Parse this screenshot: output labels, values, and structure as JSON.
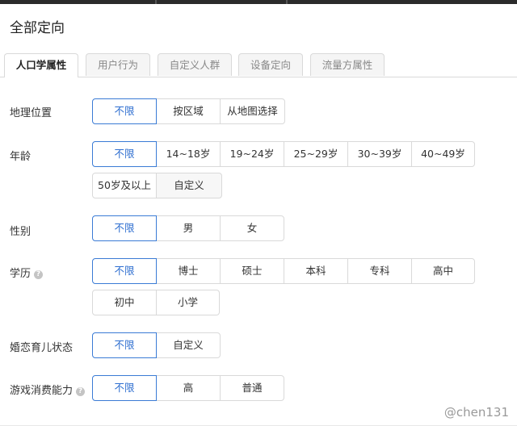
{
  "page": {
    "title": "全部定向"
  },
  "tabs": [
    "人口学属性",
    "用户行为",
    "自定义人群",
    "设备定向",
    "流量方属性"
  ],
  "active_tab": "人口学属性",
  "rows": [
    {
      "label": "地理位置",
      "options": [
        "不限",
        "按区域",
        "从地图选择"
      ]
    },
    {
      "label": "年龄",
      "options": [
        "不限",
        "14~18岁",
        "19~24岁",
        "25~29岁",
        "30~39岁",
        "40~49岁",
        "50岁及以上",
        "自定义"
      ]
    },
    {
      "label": "性别",
      "options": [
        "不限",
        "男",
        "女"
      ]
    },
    {
      "label": "学历",
      "options": [
        "不限",
        "博士",
        "硕士",
        "本科",
        "专科",
        "高中",
        "初中",
        "小学"
      ]
    },
    {
      "label": "婚恋育儿状态",
      "options": [
        "不限",
        "自定义"
      ]
    },
    {
      "label": "游戏消费能力",
      "options": [
        "不限",
        "高",
        "普通"
      ]
    }
  ],
  "selected_option": "不限",
  "help_glyph": "?",
  "watermark": "@chen131",
  "colors": {
    "accent": "#3a7bd5",
    "border": "#d9d9d9",
    "tab_bg": "#f5f5f5",
    "topbar": "#2b2b2b"
  }
}
